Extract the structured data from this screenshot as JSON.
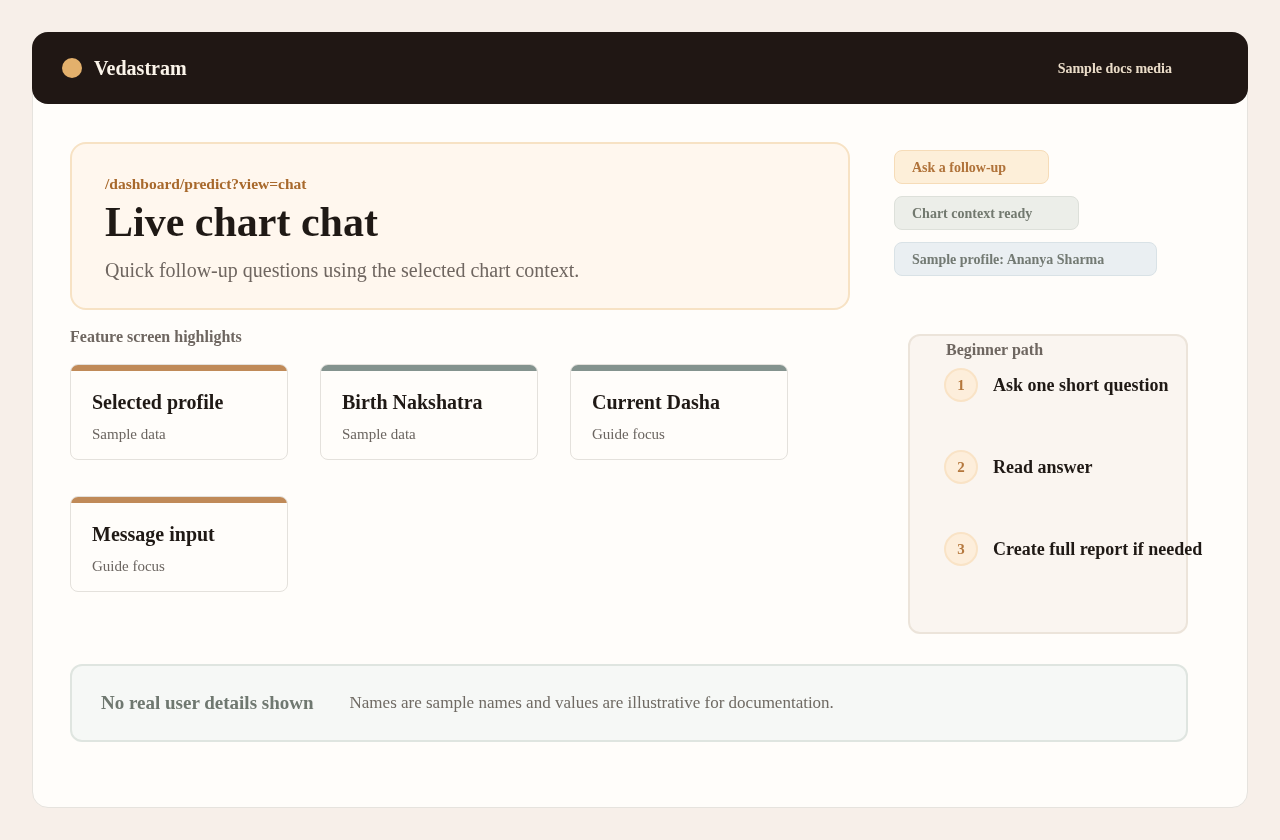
{
  "header": {
    "brand": "Vedastram",
    "link": "Sample docs media"
  },
  "hero": {
    "path": "/dashboard/predict?view=chat",
    "title": "Live chart chat",
    "subtitle": "Quick follow-up questions using the selected chart context."
  },
  "chips": [
    {
      "kind": "action",
      "label": "Ask a follow-up"
    },
    {
      "kind": "status",
      "label": "Chart context ready"
    },
    {
      "kind": "profile",
      "label": "Sample profile: Ananya Sharma"
    }
  ],
  "highlights": {
    "heading": "Feature screen highlights",
    "cards": [
      {
        "title": "Selected profile",
        "note": "Sample data",
        "color": "#c08a58"
      },
      {
        "title": "Birth Nakshatra",
        "note": "Sample data",
        "color": "#84938e"
      },
      {
        "title": "Current Dasha",
        "note": "Guide focus",
        "color": "#84938e"
      },
      {
        "title": "Message input",
        "note": "Guide focus",
        "color": "#c08a58"
      }
    ]
  },
  "beginner_path": {
    "heading": "Beginner path",
    "steps": [
      {
        "number": "1",
        "text": "Ask one short question"
      },
      {
        "number": "2",
        "text": "Read answer"
      },
      {
        "number": "3",
        "text": "Create full report if needed"
      }
    ]
  },
  "notice": {
    "title": "No real user details shown",
    "text": "Names are sample names and values are illustrative for documentation."
  }
}
